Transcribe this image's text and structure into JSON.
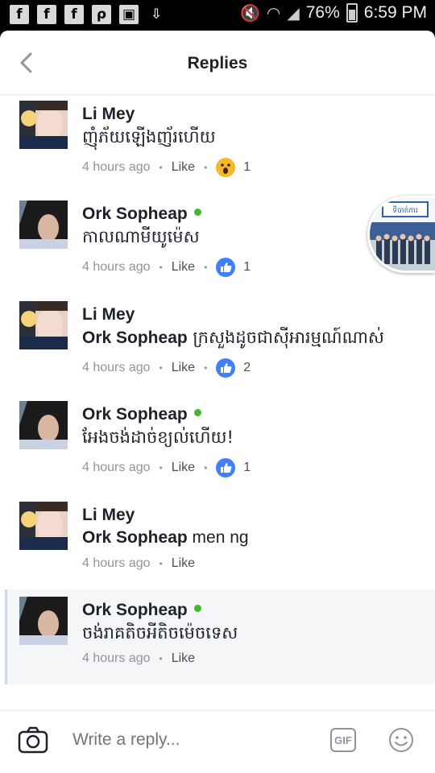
{
  "statusbar": {
    "battery": "76%",
    "time": "6:59 PM",
    "left_icons": [
      "facebook-icon",
      "facebook-icon",
      "facebook-icon",
      "messenger-icon",
      "photo-icon",
      "download-icon"
    ],
    "right_icons": [
      "mute-icon",
      "wifi-icon",
      "signal-icon",
      "battery-icon"
    ]
  },
  "header": {
    "title": "Replies"
  },
  "replies": [
    {
      "name": "Li Mey",
      "online": false,
      "mention": "",
      "text": "ញុំភ័យឡើងញ័រហើយ",
      "time": "4 hours ago",
      "like_label": "Like",
      "reaction": "wow",
      "reaction_count": "1"
    },
    {
      "name": "Ork Sopheap",
      "online": true,
      "mention": "",
      "text": "កាលណាមីយូម៉េស",
      "time": "4 hours ago",
      "like_label": "Like",
      "reaction": "like",
      "reaction_count": "1"
    },
    {
      "name": "Li Mey",
      "online": false,
      "mention": "Ork Sopheap",
      "text": " ក្រសួងដូចជាស៊ីអារម្មណ៍ណាស់",
      "time": "4 hours ago",
      "like_label": "Like",
      "reaction": "like",
      "reaction_count": "2"
    },
    {
      "name": "Ork Sopheap",
      "online": true,
      "mention": "",
      "text": "អែងចង់ដាច់ខ្យល់ហើយ!",
      "time": "4 hours ago",
      "like_label": "Like",
      "reaction": "like",
      "reaction_count": "1"
    },
    {
      "name": "Li Mey",
      "online": false,
      "mention": "Ork Sopheap",
      "text": " men ng",
      "time": "4 hours ago",
      "like_label": "Like",
      "reaction": "",
      "reaction_count": ""
    },
    {
      "name": "Ork Sopheap",
      "online": true,
      "mention": "",
      "text": "ចង់រាគតិចអីតិចម៉េចទេស",
      "time": "4 hours ago",
      "like_label": "Like",
      "reaction": "",
      "reaction_count": ""
    }
  ],
  "chathead": {
    "sign_text": "ទីបាត់ការ"
  },
  "composer": {
    "placeholder": "Write a reply...",
    "gif_label": "GIF"
  },
  "colors": {
    "link_blue": "#4080ff",
    "online_green": "#42b72a",
    "wow_yellow": "#f7b928",
    "text": "#1d2129",
    "meta": "#90949c"
  }
}
